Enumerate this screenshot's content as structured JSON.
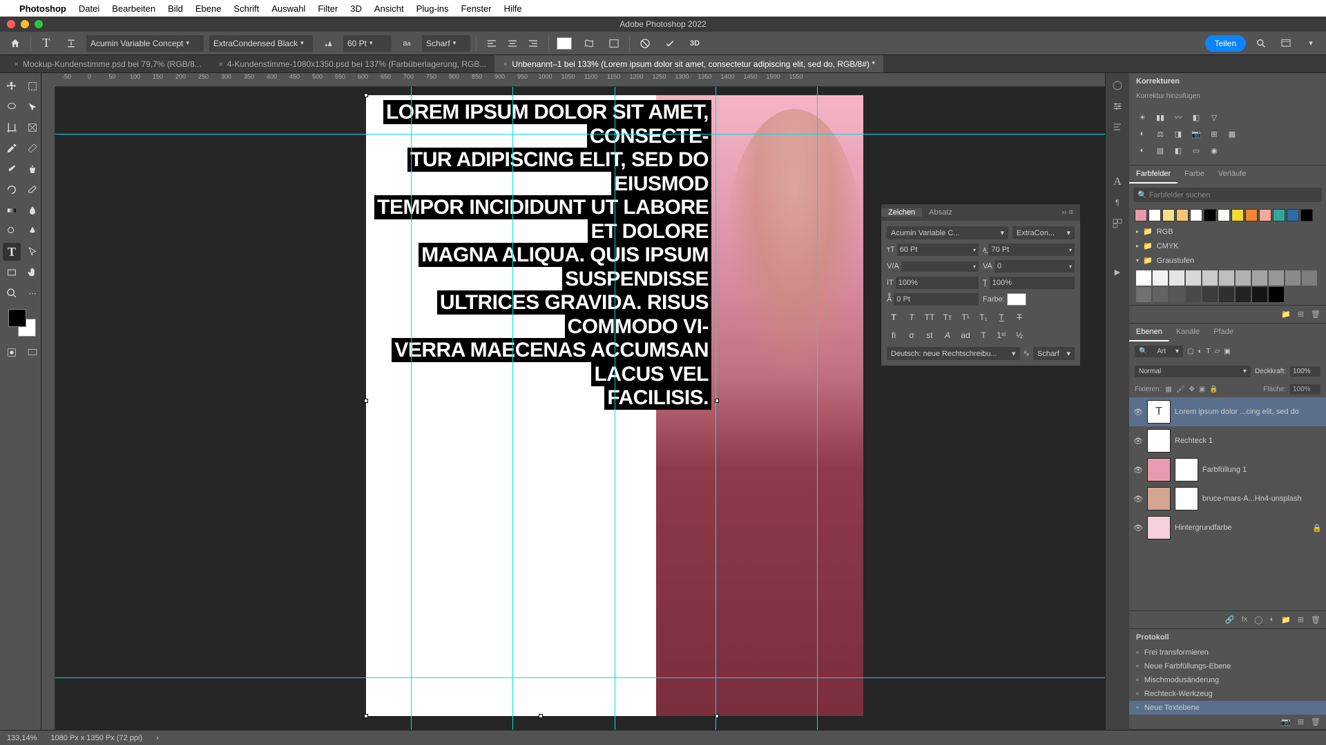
{
  "menubar": {
    "items": [
      "Photoshop",
      "Datei",
      "Bearbeiten",
      "Bild",
      "Ebene",
      "Schrift",
      "Auswahl",
      "Filter",
      "3D",
      "Ansicht",
      "Plug-ins",
      "Fenster",
      "Hilfe"
    ]
  },
  "window_title": "Adobe Photoshop 2022",
  "option_bar": {
    "font": "Acumin Variable Concept",
    "style": "ExtraCondensed Black",
    "size": "60 Pt",
    "aa": "Scharf",
    "share": "Teilen",
    "threed": "3D"
  },
  "tabs": [
    {
      "label": "Mockup-Kundenstimme.psd bei 79,7% (RGB/8...",
      "active": false
    },
    {
      "label": "4-Kundenstimme-1080x1350.psd bei 137% (Farbüberlagerung, RGB...",
      "active": false
    },
    {
      "label": "Unbenannt–1 bei 133% (Lorem ipsum dolor sit amet, consectetur adipiscing elit, sed do, RGB/8#) *",
      "active": true
    }
  ],
  "ruler_ticks": [
    "-50",
    "0",
    "50",
    "100",
    "150",
    "200",
    "250",
    "300",
    "350",
    "400",
    "450",
    "500",
    "550",
    "600",
    "650",
    "700",
    "750",
    "800",
    "850",
    "900",
    "950",
    "1000",
    "1050",
    "1100",
    "1150",
    "1200",
    "1250",
    "1300",
    "1350",
    "1400",
    "1450",
    "1500",
    "1550"
  ],
  "canvas_text": [
    "LOREM IPSUM DOLOR SIT AMET, CONSECTE-",
    "TUR ADIPISCING ELIT, SED DO EIUSMOD",
    "TEMPOR INCIDIDUNT UT LABORE ET DOLORE",
    "MAGNA ALIQUA. QUIS IPSUM SUSPENDISSE",
    "ULTRICES GRAVIDA. RISUS COMMODO VI-",
    "VERRA MAECENAS ACCUMSAN LACUS VEL",
    "FACILISIS."
  ],
  "char_panel": {
    "tabs": [
      "Zeichen",
      "Absatz"
    ],
    "font": "Acumin Variable C...",
    "style": "ExtraCon...",
    "size": "60 Pt",
    "leading": "70 Pt",
    "tracking": "0",
    "vscale": "100%",
    "hscale": "100%",
    "baseline": "0 Pt",
    "color_label": "Farbe:",
    "language": "Deutsch: neue Rechtschreibu...",
    "aa": "Scharf"
  },
  "corrections": {
    "title": "Korrekturen",
    "subtitle": "Korrektur hinzufügen"
  },
  "swatches": {
    "tabs": [
      "Farbfelder",
      "Farbe",
      "Verläufe"
    ],
    "search": "Farbfelder suchen",
    "groups": [
      "RGB",
      "CMYK",
      "Graustufen"
    ],
    "colors": [
      "#e89ab0",
      "#fff",
      "#f5e08a",
      "#f5c67a",
      "#fff",
      "#000",
      "#fff",
      "#f5d732",
      "#f58732",
      "#f5a99a",
      "#2ca89e",
      "#2c6ba8",
      "#000"
    ],
    "grays": [
      "#fff",
      "#f2f2f2",
      "#e5e5e5",
      "#d8d8d8",
      "#cbcbcb",
      "#bebebe",
      "#b1b1b1",
      "#a4a4a4",
      "#979797",
      "#8a8a8a",
      "#7d7d7d",
      "#707070",
      "#636363",
      "#565656",
      "#494949",
      "#3c3c3c",
      "#2f2f2f",
      "#222",
      "#151515",
      "#000"
    ]
  },
  "layers": {
    "tabs": [
      "Ebenen",
      "Kanäle",
      "Pfade"
    ],
    "kind": "Art",
    "blend": "Normal",
    "opacity_label": "Deckkraft:",
    "opacity": "100%",
    "fill_label": "Fläche:",
    "fill": "100%",
    "lock_label": "Fixieren:",
    "items": [
      {
        "name": "Lorem ipsum dolor ...cing elit, sed do",
        "thumb": "T",
        "selected": true,
        "color": "#fff"
      },
      {
        "name": "Rechteck 1",
        "thumb": "",
        "color": "#fff"
      },
      {
        "name": "Farbfüllung 1",
        "thumb": "",
        "color": "#e89ab0",
        "hasMask": true
      },
      {
        "name": "bruce-mars-A...Hn4-unsplash",
        "thumb": "",
        "color": "#d4a590",
        "hasMask": true
      },
      {
        "name": "Hintergrundfarbe",
        "thumb": "",
        "color": "#f5d0db",
        "locked": true
      }
    ]
  },
  "history": {
    "title": "Protokoll",
    "items": [
      "Frei transformieren",
      "Neue Farbfüllungs-Ebene",
      "Mischmodusänderung",
      "Rechteck-Werkzeug",
      "Neue Textebene"
    ]
  },
  "status": {
    "zoom": "133,14%",
    "size": "1080 Px x 1350 Px (72 ppi)"
  }
}
